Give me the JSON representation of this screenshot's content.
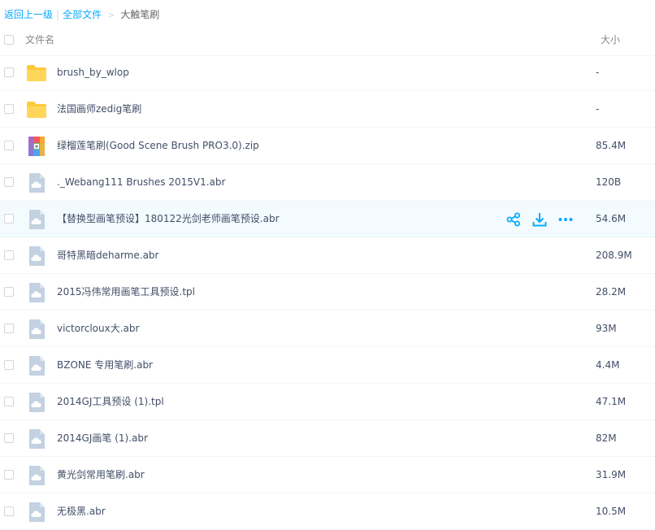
{
  "breadcrumb": {
    "back_label": "返回上一级",
    "all_files_label": "全部文件",
    "separator_bar": "|",
    "separator_gt": ">",
    "current": "大触笔刷"
  },
  "table_header": {
    "name_label": "文件名",
    "size_label": "大小"
  },
  "colors": {
    "accent": "#09aaff",
    "folder": "#ffd04d",
    "generic_file": "#c3d1e1",
    "hover_row": "#f4fbff"
  },
  "files": [
    {
      "name": "brush_by_wlop",
      "size": "-",
      "icon": "folder-icon"
    },
    {
      "name": "法国画师zedig笔刷",
      "size": "-",
      "icon": "folder-icon"
    },
    {
      "name": "绿榴莲笔刷(Good Scene Brush PRO3.0).zip",
      "size": "85.4M",
      "icon": "zip-archive-icon"
    },
    {
      "name": "._Webang111 Brushes 2015V1.abr",
      "size": "120B",
      "icon": "cloud-file-icon"
    },
    {
      "name": "【替换型画笔预设】180122光剑老师画笔预设.abr",
      "size": "54.6M",
      "icon": "cloud-file-icon"
    },
    {
      "name": "哥特黑暗deharme.abr",
      "size": "208.9M",
      "icon": "cloud-file-icon"
    },
    {
      "name": "2015冯伟常用画笔工具预设.tpl",
      "size": "28.2M",
      "icon": "cloud-file-icon"
    },
    {
      "name": "victorcloux大.abr",
      "size": "93M",
      "icon": "cloud-file-icon"
    },
    {
      "name": "BZONE 专用笔刷.abr",
      "size": "4.4M",
      "icon": "cloud-file-icon"
    },
    {
      "name": "2014GJ工具预设 (1).tpl",
      "size": "47.1M",
      "icon": "cloud-file-icon"
    },
    {
      "name": "2014GJ画笔 (1).abr",
      "size": "82M",
      "icon": "cloud-file-icon"
    },
    {
      "name": "黄光剑常用笔刷.abr",
      "size": "31.9M",
      "icon": "cloud-file-icon"
    },
    {
      "name": "无极黑.abr",
      "size": "10.5M",
      "icon": "cloud-file-icon"
    }
  ],
  "hover_row_actions": [
    "share-icon",
    "download-icon",
    "more-icon"
  ]
}
